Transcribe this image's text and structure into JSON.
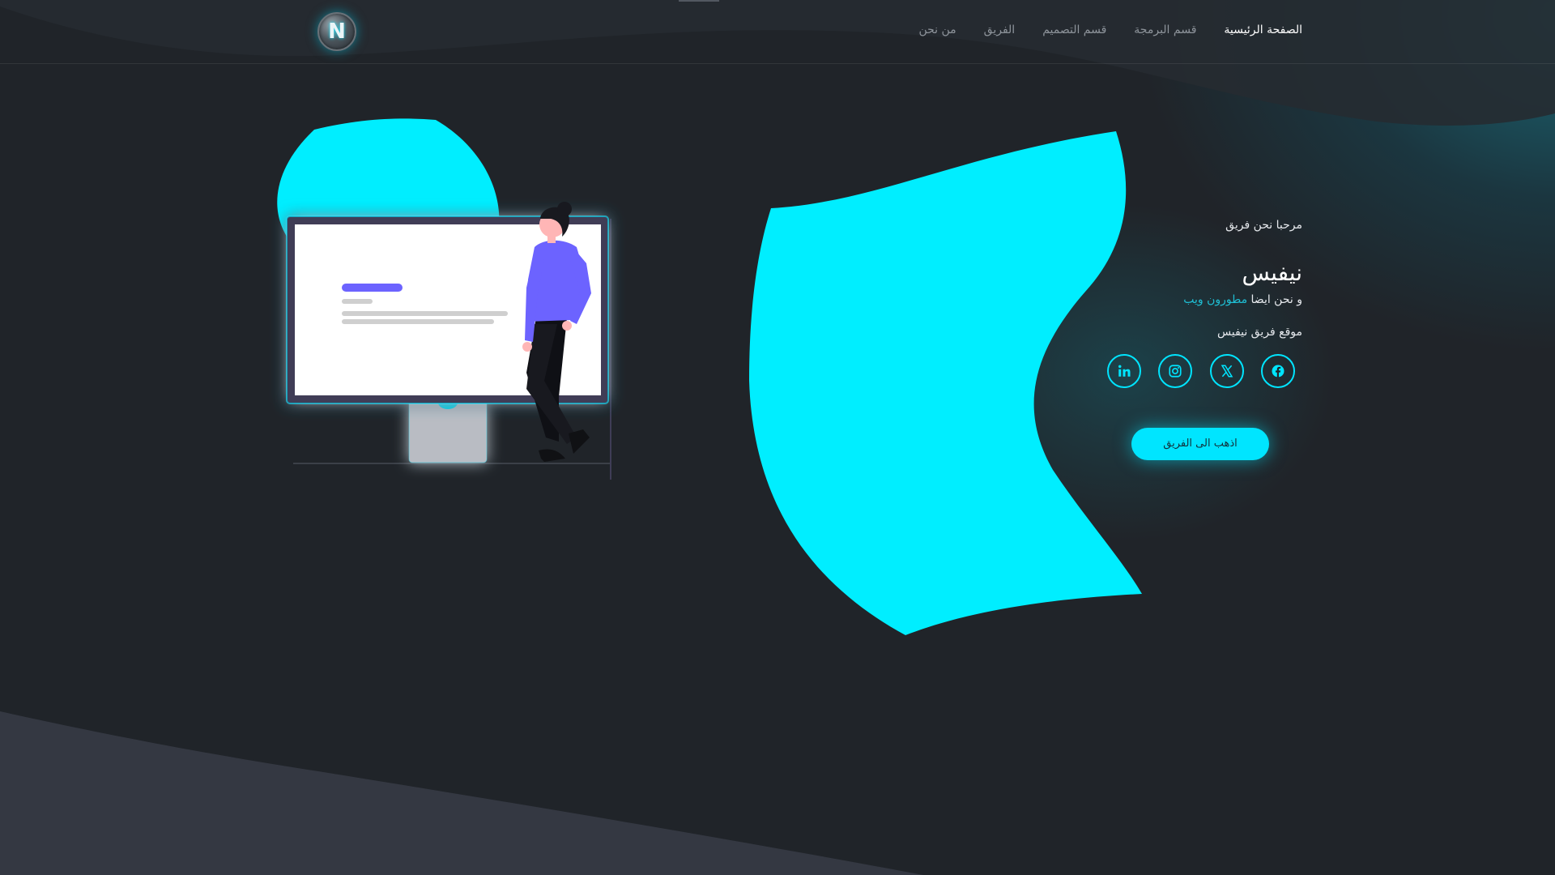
{
  "header": {
    "logo_letter": "N",
    "nav_items": [
      {
        "label": "الصفحة الرئيسية",
        "active": true
      },
      {
        "label": "قسم البرمجة",
        "active": false
      },
      {
        "label": "قسم التصميم",
        "active": false
      },
      {
        "label": "الفريق",
        "active": false
      },
      {
        "label": "من نحن",
        "active": false
      }
    ]
  },
  "hero": {
    "greeting": "مرحبا نحن فريق",
    "team_name": "نيفيس",
    "tagline_prefix": "و نحن ايضا ",
    "tagline_accent": "مطورون ويب",
    "site_label": "موقع فريق نيفيس",
    "cta_label": "اذهب الى الفريق"
  },
  "social_icons": [
    "facebook-icon",
    "x-twitter-icon",
    "instagram-icon",
    "linkedin-icon"
  ],
  "colors": {
    "background": "#202429",
    "accent": "#00e5ff",
    "accent_text": "#1fbfd4",
    "lower_panel": "#343842",
    "person_shirt": "#6c63ff"
  }
}
